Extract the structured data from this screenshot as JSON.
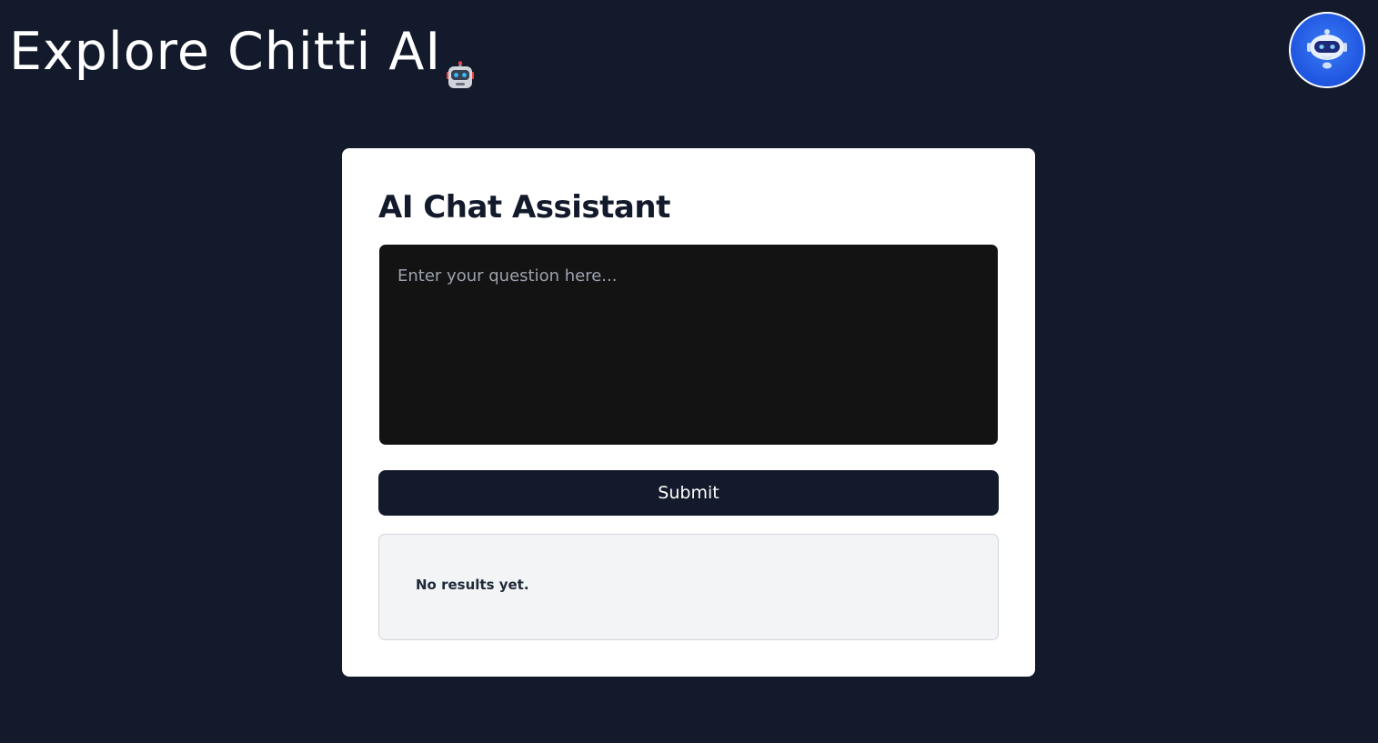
{
  "header": {
    "title": "Explore Chitti AI",
    "title_icon": "robot-emoji-icon"
  },
  "avatar": {
    "icon": "chatbot-avatar-icon",
    "background": "#2563eb"
  },
  "chat": {
    "title": "AI Chat Assistant",
    "input_placeholder": "Enter your question here...",
    "input_value": "",
    "submit_label": "Submit",
    "results_text": "No results yet."
  },
  "colors": {
    "page_background": "#131a2b",
    "card_background": "#ffffff",
    "input_background": "#131313",
    "button_background": "#131a2b",
    "results_background": "#f3f4f6"
  }
}
